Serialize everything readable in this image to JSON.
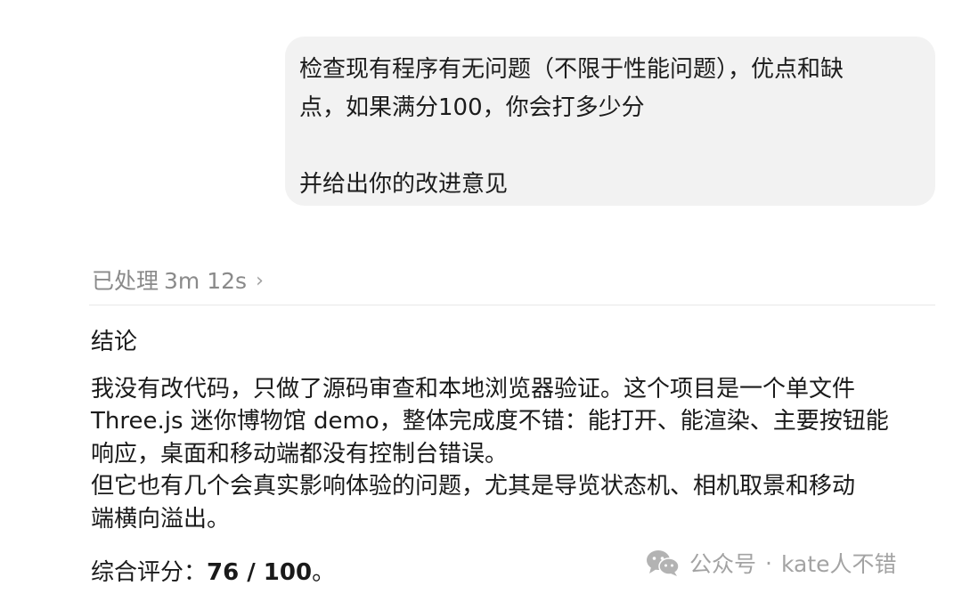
{
  "user_message": {
    "lines": [
      "检查现有程序有无问题（不限于性能问题），优点和缺",
      "点，如果满分100，你会打多少分",
      "",
      "并给出你的改进意见"
    ]
  },
  "assistant": {
    "processed_label": "已处理",
    "processed_time": "3m 12s",
    "expand_chevron": "›",
    "section_title": "结论",
    "body_lines": [
      "我没有改代码，只做了源码审查和本地浏览器验证。这个项目是一个单文件",
      "Three.js 迷你博物馆 demo，整体完成度不错：能打开、能渲染、主要按钮能",
      "响应，桌面和移动端都没有控制台错误。",
      "但它也有几个会真实影响体验的问题，尤其是导览状态机、相机取景和移动",
      "端横向溢出。"
    ],
    "score_label": "综合评分：",
    "score_value": "76 / 100",
    "score_suffix": "。"
  },
  "watermark": {
    "icon": "wechat-icon",
    "platform": "公众号",
    "separator": "·",
    "account": "kate人不错"
  },
  "colors": {
    "bubble_bg": "#f2f2f2",
    "muted_text": "#8a8a8a",
    "watermark_text": "#a3a3a3",
    "body_text": "#1a1a1a"
  }
}
